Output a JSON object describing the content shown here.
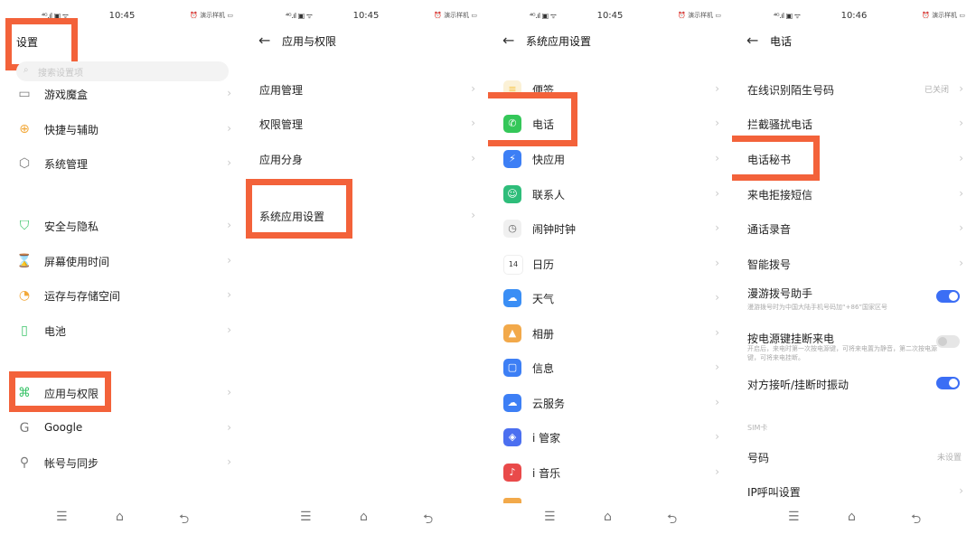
{
  "status": {
    "signal": "⁴ᴳ.ıl ▣ ᯤ",
    "time_1": "10:45",
    "time_2": "10:45",
    "time_3": "10:45",
    "time_4": "10:46",
    "right": "⏰ 演示样机 ▭"
  },
  "panel1": {
    "title": "设置",
    "search_placeholder": "搜索设置项",
    "items": [
      {
        "label": "游戏魔盒",
        "icon": "game-icon"
      },
      {
        "label": "快捷与辅助",
        "icon": "shortcut-icon"
      },
      {
        "label": "系统管理",
        "icon": "system-icon"
      },
      {
        "label": "安全与隐私",
        "icon": "shield-icon"
      },
      {
        "label": "屏幕使用时间",
        "icon": "hourglass-icon"
      },
      {
        "label": "运存与存储空间",
        "icon": "storage-icon"
      },
      {
        "label": "电池",
        "icon": "battery-icon"
      },
      {
        "label": "应用与权限",
        "icon": "apps-icon"
      },
      {
        "label": "Google",
        "icon": "google-icon"
      },
      {
        "label": "帐号与同步",
        "icon": "account-icon"
      }
    ]
  },
  "panel2": {
    "title": "应用与权限",
    "items": [
      {
        "label": "应用管理"
      },
      {
        "label": "权限管理"
      },
      {
        "label": "应用分身"
      },
      {
        "label": "系统应用设置"
      }
    ]
  },
  "panel3": {
    "title": "系统应用设置",
    "items": [
      {
        "label": "便签",
        "icon": "notes-icon",
        "color": "#f5c444"
      },
      {
        "label": "电话",
        "icon": "phone-icon",
        "color": "#34c759"
      },
      {
        "label": "快应用",
        "icon": "quickapp-icon",
        "color": "#3d7ff5"
      },
      {
        "label": "联系人",
        "icon": "contacts-icon",
        "color": "#2ebd7a"
      },
      {
        "label": "闹钟时钟",
        "icon": "clock-icon",
        "color": "#e8e8e8"
      },
      {
        "label": "日历",
        "icon": "calendar-icon",
        "color": "#ffffff"
      },
      {
        "label": "天气",
        "icon": "weather-icon",
        "color": "#3a8ef5"
      },
      {
        "label": "相册",
        "icon": "gallery-icon",
        "color": "#f2a94a"
      },
      {
        "label": "信息",
        "icon": "message-icon",
        "color": "#3d7ff5"
      },
      {
        "label": "云服务",
        "icon": "cloud-icon",
        "color": "#3d7ff5"
      },
      {
        "label": "i 管家",
        "icon": "imanager-icon",
        "color": "#4b6ff0"
      },
      {
        "label": "i 音乐",
        "icon": "music-icon",
        "color": "#e94a4a"
      }
    ]
  },
  "panel4": {
    "title": "电话",
    "items": [
      {
        "label": "在线识别陌生号码",
        "value": "已关闭"
      },
      {
        "label": "拦截骚扰电话"
      },
      {
        "label": "电话秘书"
      },
      {
        "label": "来电拒接短信"
      },
      {
        "label": "通话录音"
      },
      {
        "label": "智能拨号"
      }
    ],
    "roaming": {
      "label": "漫游拨号助手",
      "desc": "漫游拨号时为中国大陆手机号码加“+86”国家区号"
    },
    "power": {
      "label": "按电源键挂断来电",
      "desc": "开启后，来电时第一次按电源键，可将来电置为静音，第二次按电源键，可将来电挂断。"
    },
    "vibrate": {
      "label": "对方接听/挂断时振动"
    },
    "sim_header": "SIM卡",
    "number": {
      "label": "号码",
      "value": "未设置"
    },
    "ip": {
      "label": "IP呼叫设置"
    }
  },
  "nav": {
    "menu": "☰",
    "home": "⌂",
    "back": "⮌"
  },
  "accent": "#f3623a"
}
